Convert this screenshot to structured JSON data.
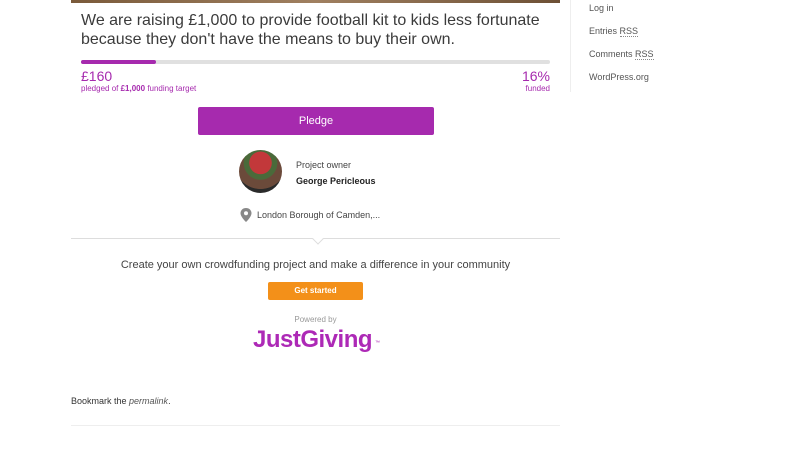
{
  "project": {
    "description": "We are raising £1,000 to provide football kit to kids less fortunate because they don't have the means to buy their own.",
    "progress_fraction": 0.16,
    "raised_amount": "£160",
    "raised_caption_prefix": "pledged of",
    "target_amount": "£1,000",
    "raised_caption_suffix": "funding target",
    "percent_funded": "16%",
    "percent_caption": "funded",
    "pledge_label": "Pledge",
    "owner_label": "Project owner",
    "owner_name": "George Pericleous",
    "location": "London Borough of Camden,..."
  },
  "cta": {
    "text": "Create your own crowdfunding project and make a difference in your community",
    "button_label": "Get started",
    "powered_by": "Powered by",
    "logo_text": "JustGiving",
    "logo_tm": "™"
  },
  "post_footer": {
    "bookmark_prefix": "Bookmark the",
    "permalink_label": "permalink",
    "bookmark_suffix": "."
  },
  "sidebar": {
    "meta_links": [
      {
        "text": "Log in"
      },
      {
        "text": "Entries ",
        "abbr": "RSS"
      },
      {
        "text": "Comments ",
        "abbr": "RSS"
      },
      {
        "text": "WordPress.org"
      }
    ]
  },
  "colors": {
    "accent_purple": "#a62aae",
    "cta_orange": "#f39019"
  },
  "icons": {
    "location": "map-pin-icon"
  }
}
